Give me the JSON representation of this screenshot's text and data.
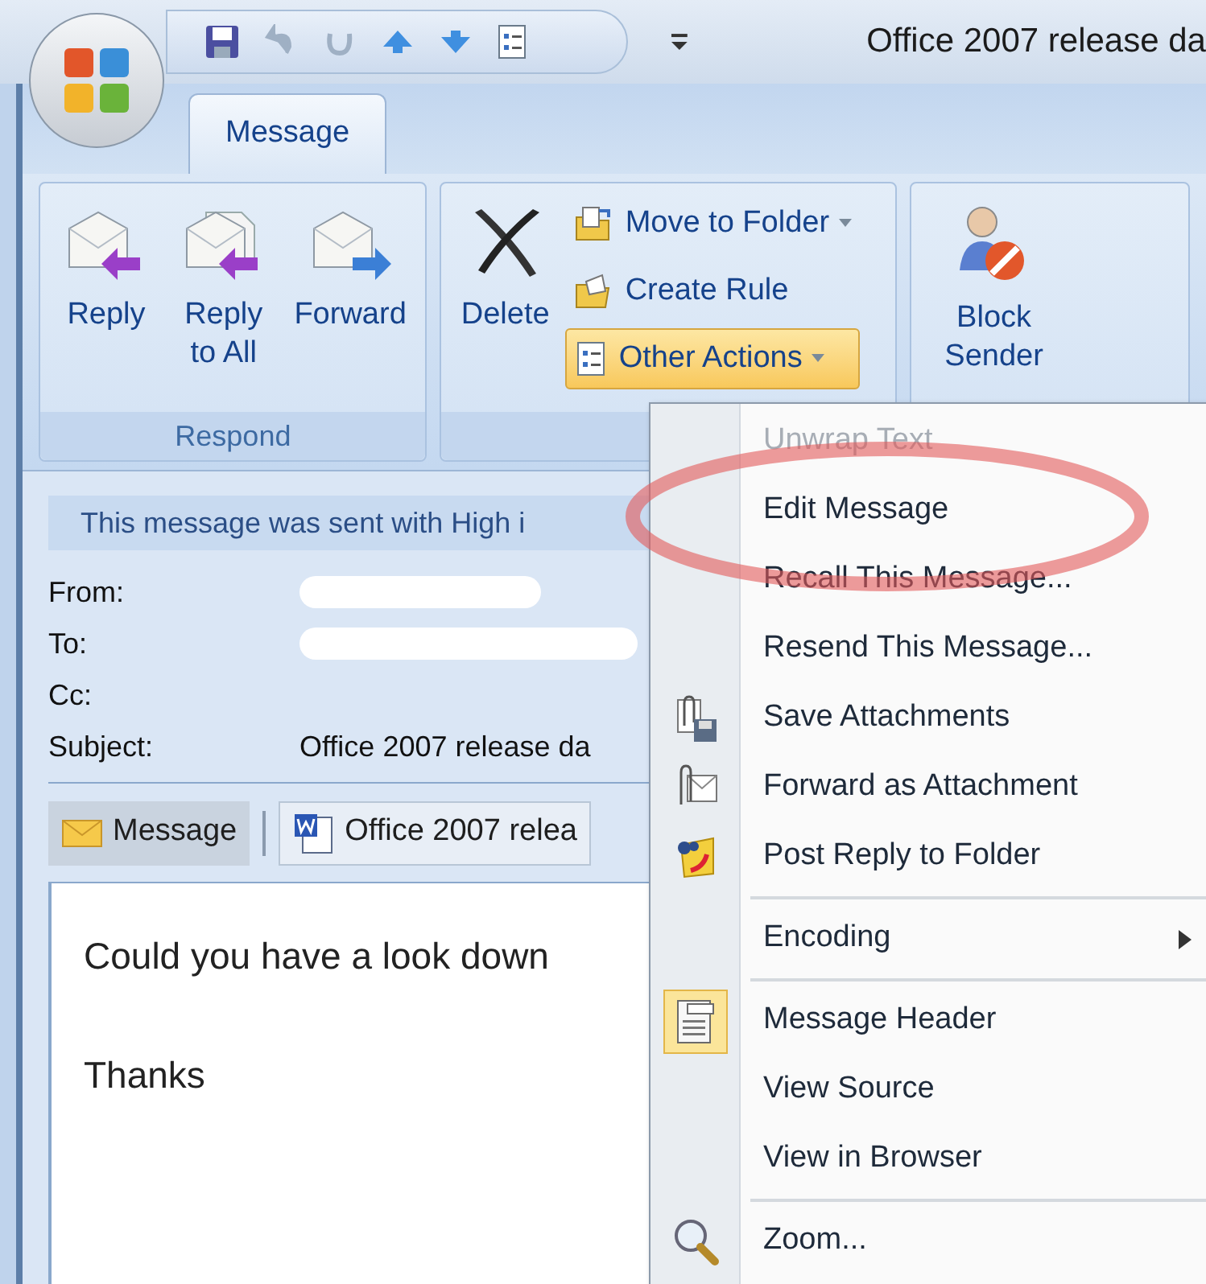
{
  "window": {
    "title": "Office 2007 release da"
  },
  "tabs": [
    {
      "label": "Message",
      "selected": true
    }
  ],
  "ribbon": {
    "groups": [
      {
        "label": "Respond",
        "large_buttons": [
          {
            "label": "Reply",
            "kind": "reply"
          },
          {
            "label": "Reply to All",
            "kind": "replyall"
          },
          {
            "label": "Forward",
            "kind": "forward"
          }
        ]
      },
      {
        "large_buttons": [
          {
            "label": "Delete",
            "kind": "delete"
          }
        ],
        "small_buttons": [
          {
            "label": "Move to Folder",
            "kind": "move",
            "dropdown": true,
            "open": false
          },
          {
            "label": "Create Rule",
            "kind": "rule",
            "dropdown": false,
            "open": false
          },
          {
            "label": "Other Actions",
            "kind": "other",
            "dropdown": true,
            "open": true
          }
        ]
      },
      {
        "large_buttons": [
          {
            "label": "Block Sender",
            "kind": "block"
          }
        ]
      }
    ]
  },
  "infobar": {
    "text": "This message was sent with High i"
  },
  "header": {
    "fields": [
      {
        "label": "From:",
        "redacted": true
      },
      {
        "label": "To:",
        "redacted": true
      },
      {
        "label": "Cc:",
        "redacted": false
      },
      {
        "label": "Subject:",
        "redacted": false,
        "value": "Office 2007 release da"
      }
    ]
  },
  "attachments": [
    {
      "label": "Message",
      "kind": "message",
      "selected": true
    },
    {
      "label": "Office 2007 relea",
      "kind": "document",
      "selected": false
    }
  ],
  "body": {
    "paragraphs": [
      "Could you have a look down",
      "Thanks"
    ]
  },
  "menu": {
    "groups": [
      [
        {
          "label": "Unwrap Text",
          "kind": "plain",
          "disabled": true,
          "checked": false,
          "submenu": false
        },
        {
          "label": "Edit Message",
          "kind": "plain",
          "disabled": false,
          "checked": false,
          "submenu": false
        },
        {
          "label": "Recall This Message...",
          "kind": "plain",
          "disabled": false,
          "checked": false,
          "submenu": false
        },
        {
          "label": "Resend This Message...",
          "kind": "plain",
          "disabled": false,
          "checked": false,
          "submenu": false
        },
        {
          "label": "Save Attachments",
          "kind": "save",
          "disabled": false,
          "checked": false,
          "submenu": false
        },
        {
          "label": "Forward as Attachment",
          "kind": "attach",
          "disabled": false,
          "checked": false,
          "submenu": false
        },
        {
          "label": "Post Reply to Folder",
          "kind": "post",
          "disabled": false,
          "checked": false,
          "submenu": false
        }
      ],
      [
        {
          "label": "Encoding",
          "kind": "plain",
          "disabled": false,
          "checked": false,
          "submenu": true
        }
      ],
      [
        {
          "label": "Message Header",
          "kind": "header",
          "disabled": false,
          "checked": true,
          "submenu": false
        },
        {
          "label": "View Source",
          "kind": "plain",
          "disabled": false,
          "checked": false,
          "submenu": false
        },
        {
          "label": "View in Browser",
          "kind": "plain",
          "disabled": false,
          "checked": false,
          "submenu": false
        }
      ],
      [
        {
          "label": "Zoom...",
          "kind": "zoom",
          "disabled": false,
          "checked": false,
          "submenu": false
        }
      ]
    ]
  }
}
